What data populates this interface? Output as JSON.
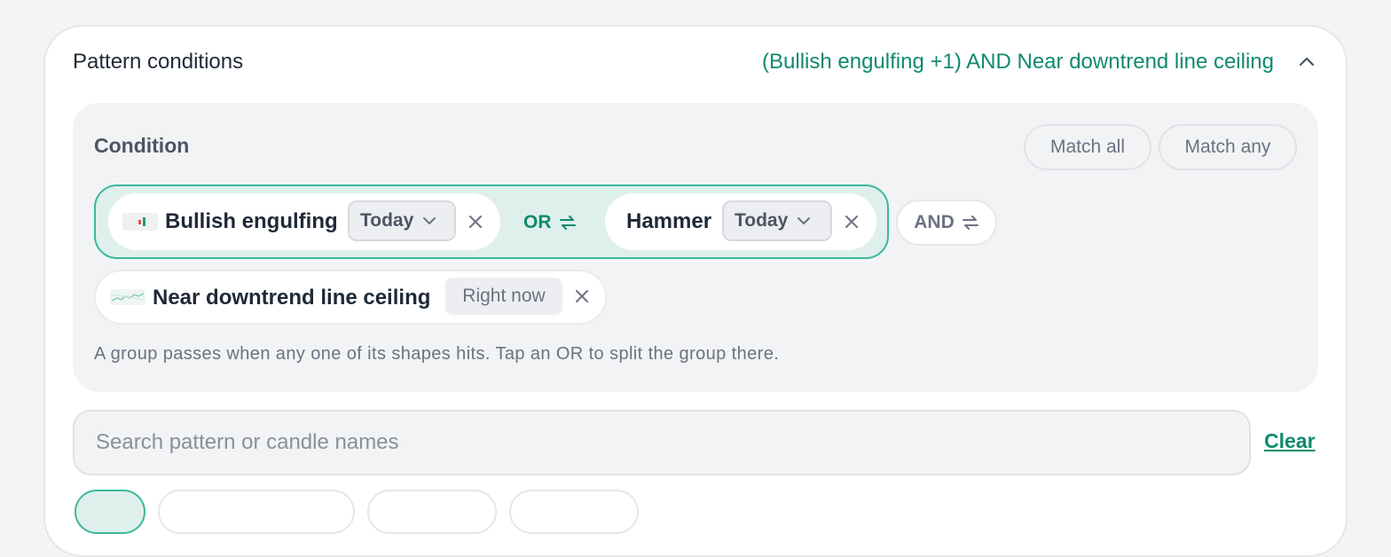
{
  "panel": {
    "title": "Pattern conditions",
    "summary": "(Bullish engulfing +1) AND Near downtrend line ceiling"
  },
  "condition": {
    "label": "Condition",
    "match_all_label": "Match all",
    "match_any_label": "Match any",
    "group": {
      "chips": [
        {
          "name": "Bullish engulfing",
          "timeframe": "Today",
          "icon": "bullish-engulfing-icon"
        },
        {
          "name": "Hammer",
          "timeframe": "Today"
        }
      ],
      "or_label": "OR"
    },
    "and_label": "AND",
    "standalone": {
      "name": "Near downtrend line ceiling",
      "timeframe": "Right now",
      "icon": "downtrend-line-icon"
    },
    "hint": "A group passes when any one of its shapes hits. Tap an OR to split the group there."
  },
  "search": {
    "placeholder": "Search pattern or candle names",
    "value": ""
  },
  "clear_label": "Clear",
  "colors": {
    "accent": "#0f8a6d",
    "group_border": "#3bb89b",
    "group_bg": "#dff0ec"
  }
}
